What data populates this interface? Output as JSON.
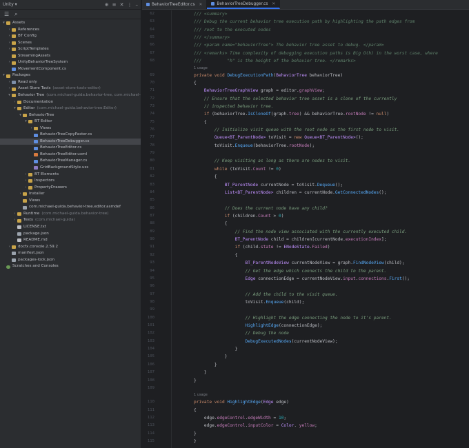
{
  "project": {
    "title": "Unity",
    "search_icon": "search-icon",
    "tree": [
      {
        "depth": 0,
        "arrow": "▾",
        "icon": "folder",
        "label": "Assets",
        "dim": ""
      },
      {
        "depth": 1,
        "arrow": "›",
        "icon": "folder",
        "label": "References",
        "dim": ""
      },
      {
        "depth": 1,
        "arrow": "›",
        "icon": "folder",
        "label": "BT Config",
        "dim": ""
      },
      {
        "depth": 1,
        "arrow": "›",
        "icon": "folder",
        "label": "Scenes",
        "dim": ""
      },
      {
        "depth": 1,
        "arrow": "›",
        "icon": "folder",
        "label": "ScriptTemplates",
        "dim": ""
      },
      {
        "depth": 1,
        "arrow": "",
        "icon": "folder",
        "label": "StreamingAssets",
        "dim": ""
      },
      {
        "depth": 1,
        "arrow": "›",
        "icon": "folder",
        "label": "UnityBehaviorTreeSystem",
        "dim": ""
      },
      {
        "depth": 1,
        "arrow": "",
        "icon": "cs",
        "label": "MovementComponent.cs",
        "dim": ""
      },
      {
        "depth": 0,
        "arrow": "▾",
        "icon": "folder",
        "label": "Packages",
        "dim": ""
      },
      {
        "depth": 1,
        "arrow": "›",
        "icon": "pkg",
        "label": "Read only",
        "dim": ""
      },
      {
        "depth": 1,
        "arrow": "›",
        "icon": "folder",
        "label": "Asset Store Tools",
        "dim": "(asset-store-tools-editor)"
      },
      {
        "depth": 1,
        "arrow": "▾",
        "icon": "folder",
        "label": "Behavior Tree",
        "dim": "(com.michael-guida.behavior-tree, com.michael-guida"
      },
      {
        "depth": 2,
        "arrow": "›",
        "icon": "folder",
        "label": "Documentation",
        "dim": ""
      },
      {
        "depth": 2,
        "arrow": "▾",
        "icon": "folder",
        "label": "Editor",
        "dim": "(com.michael-guida.behavior-tree.Editor)"
      },
      {
        "depth": 3,
        "arrow": "▾",
        "icon": "folder",
        "label": "BehaviorTree",
        "dim": ""
      },
      {
        "depth": 4,
        "arrow": "▾",
        "icon": "folder",
        "label": "BT Editor",
        "dim": ""
      },
      {
        "depth": 5,
        "arrow": "›",
        "icon": "folder",
        "label": "Views",
        "dim": ""
      },
      {
        "depth": 5,
        "arrow": "",
        "icon": "cs",
        "label": "BehaviorTreeCopyPaster.cs",
        "dim": ""
      },
      {
        "depth": 5,
        "arrow": "",
        "icon": "cs",
        "label": "BehaviorTreeDebugger.cs",
        "dim": "",
        "selected": true
      },
      {
        "depth": 5,
        "arrow": "",
        "icon": "cs",
        "label": "BehaviorTreeEditor.cs",
        "dim": ""
      },
      {
        "depth": 5,
        "arrow": "",
        "icon": "uxml",
        "label": "BehaviorTreeEditor.uxml",
        "dim": ""
      },
      {
        "depth": 5,
        "arrow": "",
        "icon": "cs",
        "label": "BehaviorTreeManager.cs",
        "dim": ""
      },
      {
        "depth": 5,
        "arrow": "",
        "icon": "uss",
        "label": "GridBackgroundStyle.uss",
        "dim": ""
      },
      {
        "depth": 4,
        "arrow": "›",
        "icon": "folder",
        "label": "BT Elements",
        "dim": ""
      },
      {
        "depth": 4,
        "arrow": "›",
        "icon": "folder",
        "label": "Inspectors",
        "dim": ""
      },
      {
        "depth": 4,
        "arrow": "›",
        "icon": "folder",
        "label": "PropertyDrawers",
        "dim": ""
      },
      {
        "depth": 3,
        "arrow": "›",
        "icon": "folder",
        "label": "Installer",
        "dim": ""
      },
      {
        "depth": 3,
        "arrow": "",
        "icon": "folder",
        "label": "Views",
        "dim": ""
      },
      {
        "depth": 3,
        "arrow": "",
        "icon": "json",
        "label": "com.michael-guida.behavior-tree.editor.asmdef",
        "dim": ""
      },
      {
        "depth": 2,
        "arrow": "›",
        "icon": "folder",
        "label": "Runtime",
        "dim": "(com.michael-guida.behavior-tree)"
      },
      {
        "depth": 2,
        "arrow": "›",
        "icon": "folder",
        "label": "Tests",
        "dim": "(com.michael-guida)"
      },
      {
        "depth": 2,
        "arrow": "",
        "icon": "txt",
        "label": "LICENSE.txt",
        "dim": ""
      },
      {
        "depth": 2,
        "arrow": "",
        "icon": "json",
        "label": "package.json",
        "dim": ""
      },
      {
        "depth": 2,
        "arrow": "",
        "icon": "txt",
        "label": "README.md",
        "dim": ""
      },
      {
        "depth": 1,
        "arrow": "›",
        "icon": "folder",
        "label": "docfx.console.2.59.2",
        "dim": ""
      },
      {
        "depth": 1,
        "arrow": "",
        "icon": "json",
        "label": "manifest.json",
        "dim": ""
      },
      {
        "depth": 1,
        "arrow": "",
        "icon": "json",
        "label": "packages-lock.json",
        "dim": ""
      },
      {
        "depth": 0,
        "arrow": "",
        "icon": "root",
        "label": "Scratches and Consoles",
        "dim": ""
      }
    ]
  },
  "tabs": [
    {
      "label": "BehaviorTreeEditor.cs",
      "active": false
    },
    {
      "label": "BehaviorTreeDebugger.cs",
      "active": true
    }
  ],
  "code": [
    {
      "n": "62",
      "t": [
        [
          "dc",
          "/// <summary>"
        ]
      ]
    },
    {
      "n": "63",
      "t": [
        [
          "dc",
          "/// Debug the current behavior tree execution path by highlighting the path edges from"
        ]
      ]
    },
    {
      "n": "64",
      "t": [
        [
          "dc",
          "/// root to the executed nodes"
        ]
      ]
    },
    {
      "n": "65",
      "t": [
        [
          "dc",
          "/// </summary>"
        ]
      ]
    },
    {
      "n": "66",
      "t": [
        [
          "dc",
          "/// <param name=\"behaviorTree\"> The behavior tree asset to debug. </param>"
        ]
      ]
    },
    {
      "n": "67",
      "t": [
        [
          "dc",
          "/// <remarks> Time complexity of debugging execution paths is Big O(h) in the worst case, where"
        ]
      ]
    },
    {
      "n": "68",
      "t": [
        [
          "dc",
          "///          \"h\" is the height of the behavior tree. </remarks>"
        ]
      ]
    },
    {
      "usage": true,
      "t": [
        [
          "",
          "1 usage"
        ]
      ]
    },
    {
      "n": "69",
      "t": [
        [
          "k",
          "private void "
        ],
        [
          "fn",
          "DebugExecutionPath"
        ],
        [
          "",
          "("
        ],
        [
          "ty",
          "BehaviorTree"
        ],
        [
          "",
          " behaviorTree)"
        ]
      ]
    },
    {
      "n": "70",
      "t": [
        [
          "",
          "{"
        ]
      ]
    },
    {
      "n": "71",
      "t": [
        [
          "",
          "    "
        ],
        [
          "ty",
          "BehaviorTreeGraphView"
        ],
        [
          "",
          " graph = editor."
        ],
        [
          "mb",
          "graphView"
        ],
        [
          "",
          ";"
        ]
      ]
    },
    {
      "n": "72",
      "t": [
        [
          "",
          "    "
        ],
        [
          "cm",
          "// Ensure that the selected behavior tree asset is a clone of the currently"
        ]
      ]
    },
    {
      "n": "73",
      "t": [
        [
          "",
          "    "
        ],
        [
          "cm",
          "// inspected behavior tree."
        ]
      ]
    },
    {
      "n": "74",
      "t": [
        [
          "",
          "    "
        ],
        [
          "k",
          "if"
        ],
        [
          "",
          " (behaviorTree."
        ],
        [
          "fn",
          "IsCloneOf"
        ],
        [
          "",
          "(graph."
        ],
        [
          "mb",
          "tree"
        ],
        [
          "",
          ") && behaviorTree."
        ],
        [
          "mb",
          "rootNode"
        ],
        [
          "",
          " != "
        ],
        [
          "k",
          "null"
        ],
        [
          "",
          ")"
        ]
      ]
    },
    {
      "n": "75",
      "t": [
        [
          "",
          "    {"
        ]
      ]
    },
    {
      "n": "76",
      "t": [
        [
          "",
          "        "
        ],
        [
          "cm",
          "// Initialize visit queue with the root node as the first node to visit."
        ]
      ]
    },
    {
      "n": "77",
      "t": [
        [
          "",
          "        "
        ],
        [
          "ty",
          "Queue<BT_ParentNode>"
        ],
        [
          "",
          " toVisit = "
        ],
        [
          "k",
          "new "
        ],
        [
          "ty",
          "Queue<BT_ParentNode>"
        ],
        [
          "",
          "();"
        ]
      ]
    },
    {
      "n": "78",
      "t": [
        [
          "",
          "        toVisit."
        ],
        [
          "fn",
          "Enqueue"
        ],
        [
          "",
          "(behaviorTree."
        ],
        [
          "mb",
          "rootNode"
        ],
        [
          "",
          ");"
        ]
      ]
    },
    {
      "n": "79",
      "t": [
        [
          "",
          ""
        ]
      ]
    },
    {
      "n": "80",
      "t": [
        [
          "",
          "        "
        ],
        [
          "cm",
          "// Keep visiting as long as there are nodes to visit."
        ]
      ]
    },
    {
      "n": "81",
      "t": [
        [
          "",
          "        "
        ],
        [
          "k",
          "while"
        ],
        [
          "",
          " (toVisit."
        ],
        [
          "mb",
          "Count"
        ],
        [
          "",
          " != "
        ],
        [
          "nm",
          "0"
        ],
        [
          "",
          ")"
        ]
      ]
    },
    {
      "n": "82",
      "t": [
        [
          "",
          "        {"
        ]
      ]
    },
    {
      "n": "83",
      "t": [
        [
          "",
          "            "
        ],
        [
          "ty",
          "BT_ParentNode"
        ],
        [
          "",
          " currentNode = toVisit."
        ],
        [
          "fn",
          "Dequeue"
        ],
        [
          "",
          "();"
        ]
      ]
    },
    {
      "n": "84",
      "t": [
        [
          "",
          "            "
        ],
        [
          "ty",
          "List<BT_ParentNode>"
        ],
        [
          "",
          " children = currentNode."
        ],
        [
          "fn",
          "GetConnectedNodes"
        ],
        [
          "",
          "();"
        ]
      ]
    },
    {
      "n": "85",
      "t": [
        [
          "",
          ""
        ]
      ]
    },
    {
      "n": "86",
      "t": [
        [
          "",
          "            "
        ],
        [
          "cm",
          "// Does the current node have any child?"
        ]
      ]
    },
    {
      "n": "87",
      "t": [
        [
          "",
          "            "
        ],
        [
          "k",
          "if"
        ],
        [
          "",
          " (children."
        ],
        [
          "mb",
          "Count"
        ],
        [
          "",
          " > "
        ],
        [
          "nm",
          "0"
        ],
        [
          "",
          ")"
        ]
      ]
    },
    {
      "n": "88",
      "t": [
        [
          "",
          "            {"
        ]
      ]
    },
    {
      "n": "89",
      "t": [
        [
          "",
          "                "
        ],
        [
          "cm",
          "// Find the node view associated with the currently executed child."
        ]
      ]
    },
    {
      "n": "90",
      "t": [
        [
          "",
          "                "
        ],
        [
          "ty",
          "BT_ParentNode"
        ],
        [
          "",
          " child = children[currentNode."
        ],
        [
          "mb",
          "executionIndex"
        ],
        [
          "",
          "];"
        ]
      ]
    },
    {
      "n": "91",
      "t": [
        [
          "",
          "                "
        ],
        [
          "k",
          "if"
        ],
        [
          "",
          " (child."
        ],
        [
          "mb",
          "state"
        ],
        [
          "",
          " != "
        ],
        [
          "ty",
          "ENodeState"
        ],
        [
          "",
          "."
        ],
        [
          "mb",
          "Failed"
        ],
        [
          "",
          ")"
        ]
      ]
    },
    {
      "n": "92",
      "t": [
        [
          "",
          "                {"
        ]
      ]
    },
    {
      "n": "93",
      "t": [
        [
          "",
          "                    "
        ],
        [
          "ty",
          "BT_ParentNodeView"
        ],
        [
          "",
          " currentNodeView = graph."
        ],
        [
          "fn",
          "FindNodeView"
        ],
        [
          "",
          "(child);"
        ]
      ]
    },
    {
      "n": "94",
      "t": [
        [
          "",
          "                    "
        ],
        [
          "cm",
          "// Get the edge which connects the child to the parent."
        ]
      ]
    },
    {
      "n": "95",
      "t": [
        [
          "",
          "                    "
        ],
        [
          "ty",
          "Edge"
        ],
        [
          "",
          " connectionEdge = currentNodeView."
        ],
        [
          "mb",
          "input"
        ],
        [
          "",
          "."
        ],
        [
          "mb",
          "connections"
        ],
        [
          "",
          "."
        ],
        [
          "fn",
          "First"
        ],
        [
          "",
          "();"
        ]
      ]
    },
    {
      "n": "96",
      "t": [
        [
          "",
          ""
        ]
      ]
    },
    {
      "n": "97",
      "t": [
        [
          "",
          "                    "
        ],
        [
          "cm",
          "// Add the child to the visit queue."
        ]
      ]
    },
    {
      "n": "98",
      "t": [
        [
          "",
          "                    toVisit."
        ],
        [
          "fn",
          "Enqueue"
        ],
        [
          "",
          "(child);"
        ]
      ]
    },
    {
      "n": "99",
      "t": [
        [
          "",
          ""
        ]
      ]
    },
    {
      "n": "100",
      "t": [
        [
          "",
          "                    "
        ],
        [
          "cm",
          "// Highlight the edge connecting the node to it's parent."
        ]
      ]
    },
    {
      "n": "101",
      "t": [
        [
          "",
          "                    "
        ],
        [
          "fn",
          "HighlightEdge"
        ],
        [
          "",
          "(connectionEdge);"
        ]
      ]
    },
    {
      "n": "102",
      "t": [
        [
          "",
          "                    "
        ],
        [
          "cm",
          "// Debug the node"
        ]
      ]
    },
    {
      "n": "103",
      "t": [
        [
          "",
          "                    "
        ],
        [
          "fn",
          "DebugExecutedNodes"
        ],
        [
          "",
          "(currentNodeView);"
        ]
      ]
    },
    {
      "n": "104",
      "t": [
        [
          "",
          "                }"
        ]
      ]
    },
    {
      "n": "105",
      "t": [
        [
          "",
          "            }"
        ]
      ]
    },
    {
      "n": "106",
      "t": [
        [
          "",
          "        }"
        ]
      ]
    },
    {
      "n": "107",
      "t": [
        [
          "",
          "    }"
        ]
      ]
    },
    {
      "n": "108",
      "t": [
        [
          "",
          "}"
        ]
      ]
    },
    {
      "n": "109",
      "t": [
        [
          "",
          ""
        ]
      ]
    },
    {
      "usage": true,
      "t": [
        [
          "",
          "1 usage"
        ]
      ]
    },
    {
      "n": "110",
      "t": [
        [
          "k",
          "private void "
        ],
        [
          "fn",
          "HighlightEdge"
        ],
        [
          "",
          "("
        ],
        [
          "ty",
          "Edge"
        ],
        [
          "",
          " edge)"
        ]
      ]
    },
    {
      "n": "111",
      "t": [
        [
          "",
          "{"
        ]
      ]
    },
    {
      "n": "112",
      "t": [
        [
          "",
          "    edge."
        ],
        [
          "mb",
          "edgeControl"
        ],
        [
          "",
          "."
        ],
        [
          "mb",
          "edgeWidth"
        ],
        [
          "",
          " = "
        ],
        [
          "nm",
          "10"
        ],
        [
          "",
          ";"
        ]
      ]
    },
    {
      "n": "113",
      "t": [
        [
          "",
          "    edge."
        ],
        [
          "mb",
          "edgeControl"
        ],
        [
          "",
          "."
        ],
        [
          "mb",
          "inputColor"
        ],
        [
          "",
          " = "
        ],
        [
          "ty",
          "Color"
        ],
        [
          "",
          ". "
        ],
        [
          "mb",
          "yellow"
        ],
        [
          "",
          ";"
        ]
      ]
    },
    {
      "n": "114",
      "t": [
        [
          "",
          "}"
        ]
      ]
    },
    {
      "n": "115",
      "t": [
        [
          "",
          "}"
        ]
      ]
    }
  ]
}
